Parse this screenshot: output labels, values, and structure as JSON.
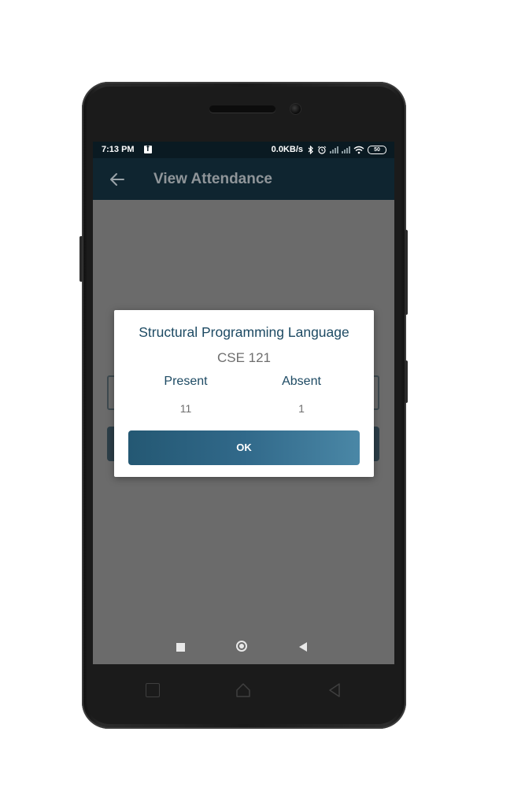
{
  "status_bar": {
    "time": "7:13 PM",
    "network_speed": "0.0KB/s",
    "battery": "50",
    "icons": [
      "facebook-icon",
      "bluetooth-icon",
      "alarm-icon",
      "signal-icon",
      "signal-icon",
      "wifi-icon",
      "battery-icon"
    ]
  },
  "app_bar": {
    "title": "View Attendance",
    "back_icon": "arrow-left-icon"
  },
  "dialog": {
    "course_name": "Structural Programming Language",
    "course_code": "CSE 121",
    "present_label": "Present",
    "absent_label": "Absent",
    "present_count": "11",
    "absent_count": "1",
    "ok_label": "OK"
  },
  "colors": {
    "app_bar": "#0f2530",
    "status_bar": "#0a1a22",
    "accent_text": "#1d4a63",
    "ok_button_start": "#245873",
    "ok_button_end": "#4a87a6",
    "scrim": "#6b6b6b"
  }
}
